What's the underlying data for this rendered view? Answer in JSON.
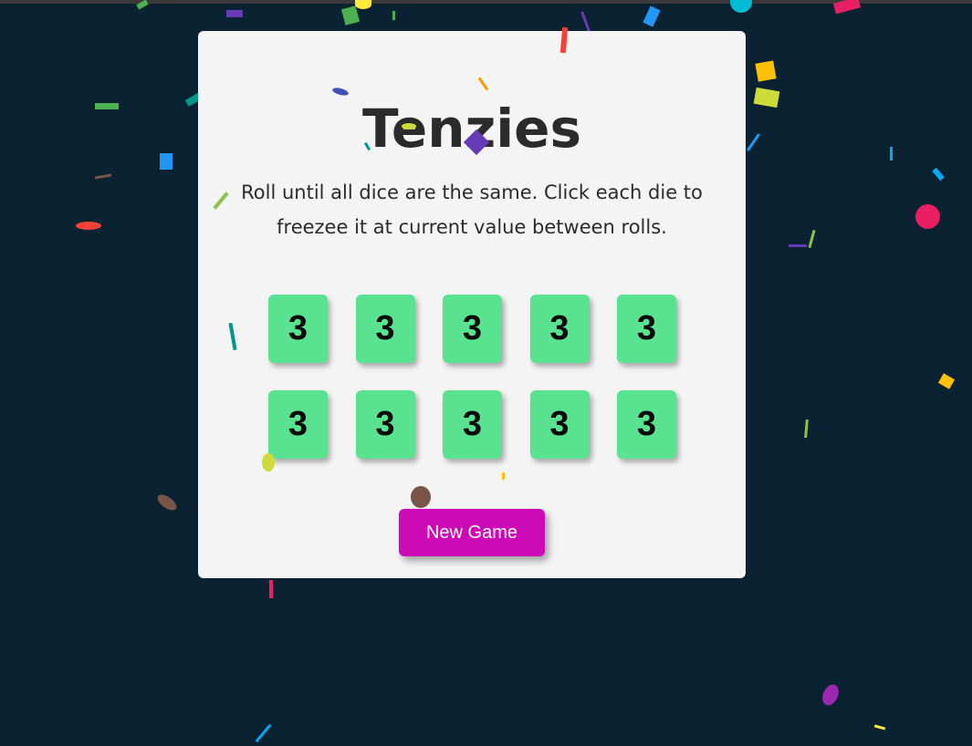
{
  "game": {
    "title": "Tenzies",
    "instructions": "Roll until all dice are the same. Click each die to freezee it at current value between rolls.",
    "dice": [
      3,
      3,
      3,
      3,
      3,
      3,
      3,
      3,
      3,
      3
    ],
    "all_held": true,
    "won": true,
    "new_game_label": "New Game"
  },
  "colors": {
    "background": "#0b2233",
    "card": "#f4f4f4",
    "die_held": "#59e391",
    "button": "#cc0bb6",
    "button_text": "#ffffff",
    "title_text": "#2b2b2b"
  },
  "confetti": {
    "visible": true,
    "palette": [
      "#f44336",
      "#e91e63",
      "#9c27b0",
      "#673ab7",
      "#3f51b5",
      "#2196f3",
      "#03a9f4",
      "#00bcd4",
      "#009688",
      "#4caf50",
      "#8bc34a",
      "#cddc39",
      "#ffeb3b",
      "#ffc107",
      "#ff9800",
      "#795548"
    ]
  }
}
